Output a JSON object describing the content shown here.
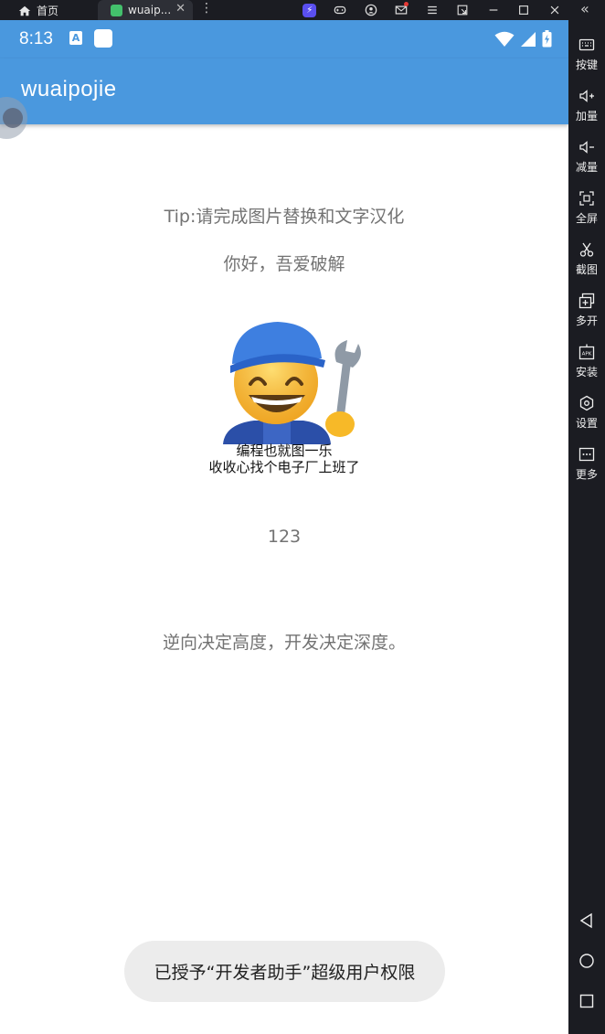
{
  "topbar": {
    "home_label": "首页",
    "tab_label": "wuaip...",
    "close_glyph": "✕",
    "more_glyph": "⋮",
    "collapse_glyph": "«"
  },
  "statusbar": {
    "time": "8:13",
    "a_badge": "A"
  },
  "appbar": {
    "title": "wuaipojie"
  },
  "content": {
    "tip": "Tip:请完成图片替换和文字汉化",
    "hello": "你好，吾爱破解",
    "meme_caption_1": "编程也就图一乐",
    "meme_caption_2": "收收心找个电子厂上班了",
    "number": "123",
    "motto": "逆向决定高度，开发决定深度。"
  },
  "toast": {
    "text": "已授予“开发者助手”超级用户权限"
  },
  "sidebar": {
    "items": [
      {
        "label": "按键",
        "icon": "keyboard-icon"
      },
      {
        "label": "加量",
        "icon": "volume-up-icon"
      },
      {
        "label": "减量",
        "icon": "volume-down-icon"
      },
      {
        "label": "全屏",
        "icon": "fullscreen-icon"
      },
      {
        "label": "截图",
        "icon": "scissors-icon"
      },
      {
        "label": "多开",
        "icon": "multi-instance-icon"
      },
      {
        "label": "安装",
        "icon": "apk-install-icon"
      },
      {
        "label": "设置",
        "icon": "settings-icon"
      },
      {
        "label": "更多",
        "icon": "more-icon"
      }
    ]
  },
  "colors": {
    "accent": "#4a98de",
    "emulator_bg": "#1b1c22",
    "text_gray": "#737373",
    "toast_bg": "#ececec"
  }
}
